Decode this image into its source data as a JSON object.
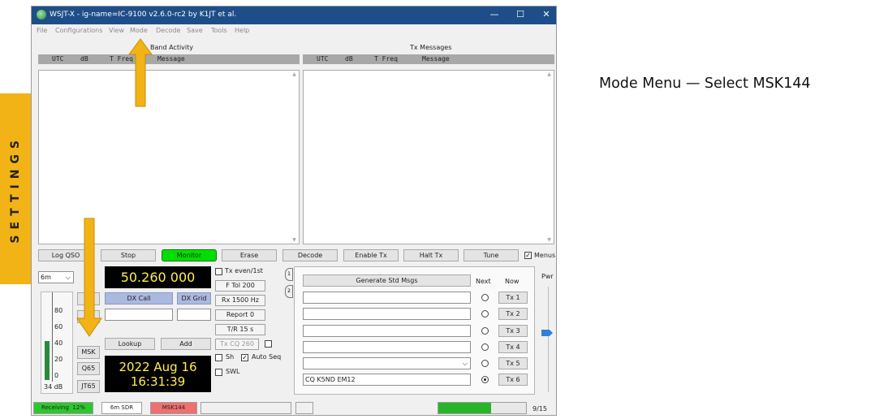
{
  "side_tab": {
    "label": "SETTINGS"
  },
  "caption": "Mode Menu — Select MSK144",
  "window": {
    "title": "WSJT-X - ig-name=IC-9100  v2.6.0-rc2  by K1JT et al.",
    "controls": {
      "minimize": "—",
      "maximize": "☐",
      "close": "✕"
    },
    "menu": [
      "File",
      "Configurations",
      "View",
      "Mode",
      "Decode",
      "Save",
      "Tools",
      "Help"
    ]
  },
  "band_activity": {
    "title": "Band Activity",
    "columns": [
      "UTC",
      "dB",
      "T Freq",
      "Message"
    ]
  },
  "tx_messages": {
    "title": "Tx Messages",
    "columns": [
      "UTC",
      "dB",
      "T Freq",
      "Message"
    ]
  },
  "buttons": {
    "log_qso": "Log QSO",
    "stop": "Stop",
    "monitor": "Monitor",
    "erase": "Erase",
    "decode": "Decode",
    "enable_tx": "Enable Tx",
    "halt_tx": "Halt Tx",
    "tune": "Tune",
    "menus": "Menus"
  },
  "band": {
    "value": "6m"
  },
  "frequency": "50.260 000",
  "dx": {
    "call_label": "DX Call",
    "grid_label": "DX Grid",
    "call_value": "",
    "grid_value": "",
    "lookup": "Lookup",
    "add": "Add"
  },
  "datetime": {
    "date": "2022 Aug 16",
    "time": "16:31:39"
  },
  "mode_buttons": [
    "MSK",
    "Q65",
    "JT65"
  ],
  "meter": {
    "ticks": [
      "80",
      "60",
      "40",
      "20",
      "0"
    ],
    "db": "34 dB"
  },
  "controls": {
    "tx_even": "Tx even/1st",
    "ftol": "F Tol  200",
    "rx": "Rx  1500  Hz",
    "report": "Report  0",
    "tr": "T/R  15  s",
    "txcq": "Tx CQ  260",
    "sh": "Sh",
    "auto_seq": "Auto Seq",
    "swl": "SWL"
  },
  "tab_labels": [
    "1",
    "2"
  ],
  "tx_panel": {
    "generate": "Generate Std Msgs",
    "next": "Next",
    "now": "Now",
    "messages": [
      "",
      "",
      "",
      "",
      "",
      "CQ K5ND EM12"
    ],
    "tx_buttons": [
      "Tx 1",
      "Tx 2",
      "Tx 3",
      "Tx 4",
      "Tx 5",
      "Tx 6"
    ],
    "selected_index": 5
  },
  "pwr": "Pwr",
  "status": {
    "receiving": "Receiving",
    "pct": "12%",
    "config": "6m SDR",
    "mode": "MSK144",
    "progress": 0.6,
    "count": "9/15"
  },
  "colors": {
    "title": "#1d4e89",
    "monitor": "#00e000",
    "dx_blue": "#aab9df",
    "mode_red": "#ef7070",
    "receiving": "#2ec62e",
    "progress": "#28b428",
    "arrow": "#f2b316"
  }
}
